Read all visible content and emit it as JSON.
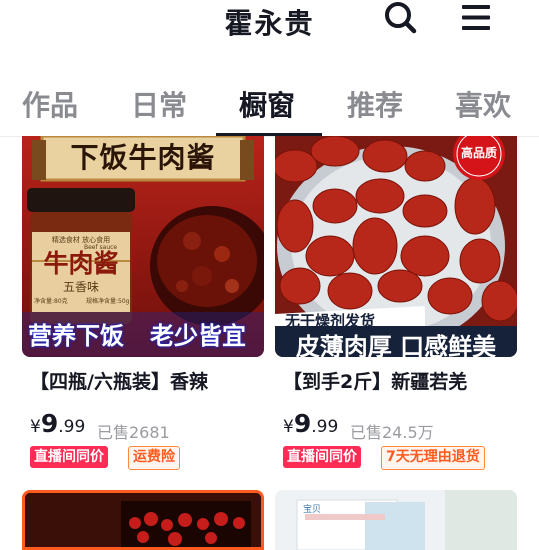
{
  "header": {
    "title": "霍永贵"
  },
  "tabs": [
    {
      "label": "作品"
    },
    {
      "label": "日常"
    },
    {
      "label": "橱窗"
    },
    {
      "label": "推荐"
    },
    {
      "label": "喜欢"
    }
  ],
  "products": [
    {
      "image_texts": {
        "banner": "下饭牛肉酱",
        "jar_top": "精选食材 放心食用",
        "jar_main": "牛肉酱",
        "jar_en": "Beef sauce",
        "jar_flavor": "五香味",
        "jar_weight": "净含量:80克",
        "jar_spec": "规格净含量:50g",
        "caption_left": "营养下饭",
        "caption_right": "老少皆宜"
      },
      "title": "【四瓶/六瓶装】香辣",
      "currency": "¥",
      "price_int": "9",
      "price_dec": ".99",
      "sold": "已售2681",
      "tags": [
        "直播间同价",
        "运费险"
      ]
    },
    {
      "image_texts": {
        "badge": "高品质",
        "ribbon": "无干燥剂发货",
        "caption": "皮薄肉厚 口感鲜美"
      },
      "title": "【到手2斤】新疆若羌",
      "currency": "¥",
      "price_int": "9",
      "price_dec": ".99",
      "sold": "已售24.5万",
      "tags": [
        "直播间同价",
        "7天无理由退货"
      ]
    }
  ],
  "bottom_card_texts": {
    "label": "宝贝"
  },
  "icons": {
    "search": "search-icon",
    "menu": "menu-icon"
  },
  "colors": {
    "red_tag": "#fe2c55",
    "outline_tag": "#ff5a1f",
    "text": "#161823",
    "muted": "#9a9ba0"
  }
}
